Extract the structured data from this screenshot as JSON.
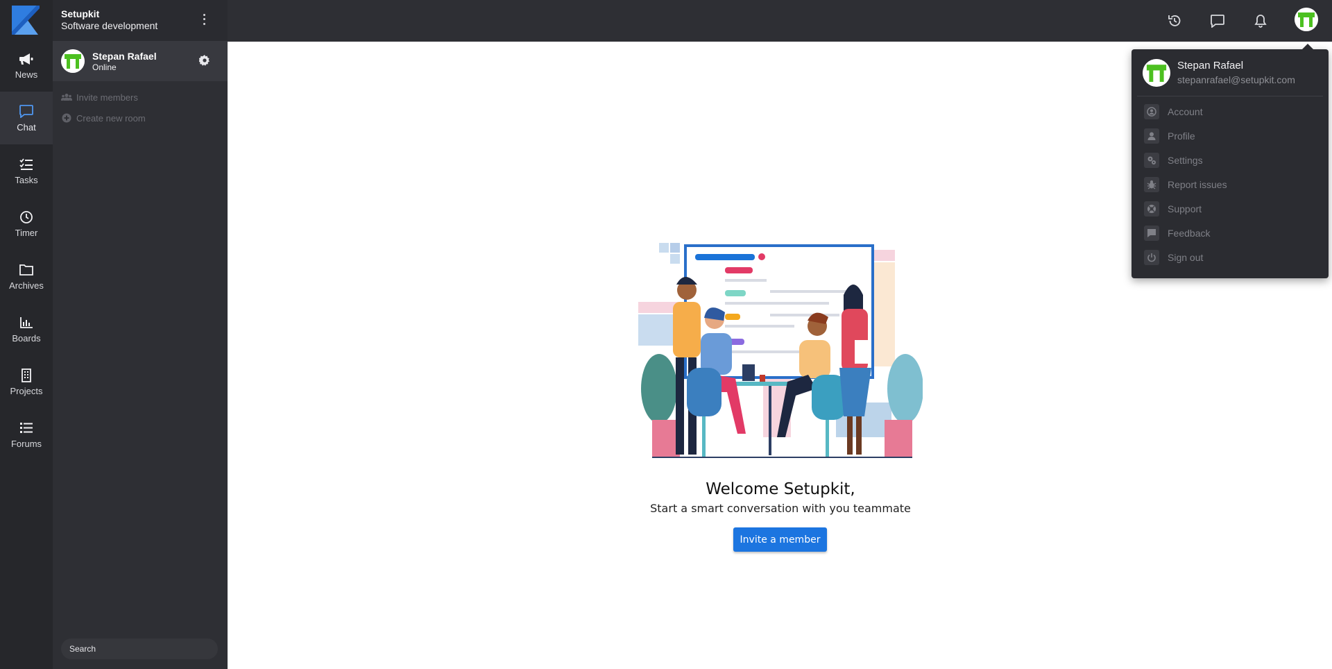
{
  "workspace": {
    "name": "Setupkit",
    "description": "Software development"
  },
  "user": {
    "name": "Stepan Rafael",
    "status": "Online",
    "email": "stepanrafael@setupkit.com"
  },
  "rail": [
    {
      "label": "News",
      "icon": "megaphone-icon"
    },
    {
      "label": "Chat",
      "icon": "chat-icon"
    },
    {
      "label": "Tasks",
      "icon": "checklist-icon"
    },
    {
      "label": "Timer",
      "icon": "clock-icon"
    },
    {
      "label": "Archives",
      "icon": "folder-icon"
    },
    {
      "label": "Boards",
      "icon": "bar-chart-icon"
    },
    {
      "label": "Projects",
      "icon": "building-icon"
    },
    {
      "label": "Forums",
      "icon": "list-icon"
    }
  ],
  "sidebar": {
    "links": [
      {
        "label": "Invite members",
        "icon": "users-icon"
      },
      {
        "label": "Create new room",
        "icon": "plus-circle-icon"
      }
    ],
    "search_placeholder": "Search"
  },
  "main": {
    "title": "Welcome Setupkit,",
    "subtitle": "Start a smart conversation with you teammate",
    "invite_button": "Invite a member"
  },
  "dropdown": {
    "items": [
      {
        "label": "Account",
        "icon": "account-icon"
      },
      {
        "label": "Profile",
        "icon": "profile-icon"
      },
      {
        "label": "Settings",
        "icon": "settings-icon"
      },
      {
        "label": "Report issues",
        "icon": "bug-icon"
      },
      {
        "label": "Support",
        "icon": "lifebuoy-icon"
      },
      {
        "label": "Feedback",
        "icon": "feedback-icon"
      },
      {
        "label": "Sign out",
        "icon": "power-icon"
      }
    ]
  },
  "colors": {
    "accent": "#1c75e0",
    "rail_bg": "#26272b",
    "sidebar_bg": "#2e2f34",
    "avatar_green": "#4cc020"
  }
}
